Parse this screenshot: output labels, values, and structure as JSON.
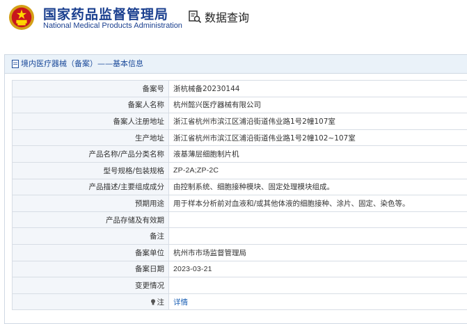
{
  "header": {
    "brand_cn": "国家药品监督管理局",
    "brand_en": "National Medical Products Administration",
    "data_query": "数据查询",
    "emblem_icon": "national-emblem-icon",
    "query_icon": "search-doc-icon"
  },
  "section": {
    "title": "境内医疗器械（备案）——基本信息"
  },
  "rows": [
    {
      "label": "备案号",
      "value": "浙杭械备20230144"
    },
    {
      "label": "备案人名称",
      "value": "杭州懿兴医疗器械有限公司"
    },
    {
      "label": "备案人注册地址",
      "value": "浙江省杭州市滨江区浦沿街道伟业路1号2幢107室"
    },
    {
      "label": "生产地址",
      "value": "浙江省杭州市滨江区浦沿街道伟业路1号2幢102~107室"
    },
    {
      "label": "产品名称/产品分类名称",
      "value": "液基薄层细胞制片机"
    },
    {
      "label": "型号规格/包装规格",
      "value": "ZP-2A;ZP-2C"
    },
    {
      "label": "产品描述/主要组成成分",
      "value": "由控制系统、细胞接种模块、固定处理模块组成。"
    },
    {
      "label": "预期用途",
      "value": "用于样本分析前对血液和/或其他体液的细胞接种、涂片、固定、染色等。"
    },
    {
      "label": "产品存储及有效期",
      "value": ""
    },
    {
      "label": "备注",
      "value": ""
    },
    {
      "label": "备案单位",
      "value": "杭州市市场监督管理局"
    },
    {
      "label": "备案日期",
      "value": "2023-03-21"
    },
    {
      "label": "变更情况",
      "value": ""
    },
    {
      "label": "注",
      "value": "详情"
    }
  ],
  "colors": {
    "brand_blue": "#1a3f8f",
    "link_blue": "#1a5fb4",
    "title_bg": "#eaf2f9",
    "label_bg": "#f3f6fa"
  }
}
